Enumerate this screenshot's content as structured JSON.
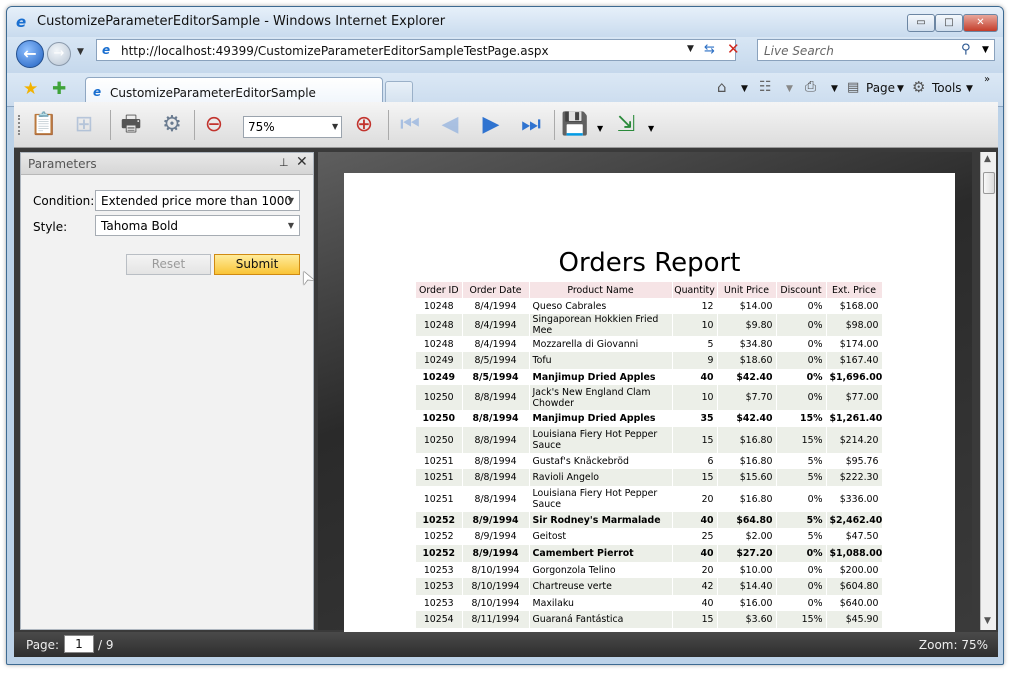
{
  "window": {
    "title": "CustomizeParameterEditorSample - Windows Internet Explorer",
    "minimize_glyph": "▭",
    "maximize_glyph": "□",
    "close_glyph": "✕"
  },
  "nav": {
    "back_glyph": "←",
    "forward_glyph": "→",
    "dropdown_glyph": "▼",
    "url": "http://localhost:49399/CustomizeParameterEditorSampleTestPage.aspx",
    "refresh_glyph": "⇆",
    "stop_glyph": "✕"
  },
  "search": {
    "placeholder": "Live Search",
    "icon_glyph": "⚲",
    "dropdown_glyph": "▼"
  },
  "tabs": [
    {
      "label": "CustomizeParameterEditorSample"
    }
  ],
  "favorites": {
    "star_glyph": "★",
    "add_glyph": "✚"
  },
  "commandbar": {
    "home_glyph": "⌂",
    "feeds_glyph": "☷",
    "print_glyph": "⎙",
    "page_glyph": "▤",
    "page_label": "Page",
    "tools_glyph": "⚙",
    "tools_label": "Tools",
    "dropdown_glyph": "▼",
    "more_glyph": "»"
  },
  "toolbar": {
    "parameters_glyph": "📋",
    "doc_map_glyph": "⊞",
    "print_glyph": "🖶",
    "print_setup_glyph": "⚙",
    "zoom_out_glyph": "⊖",
    "zoom_value": "75%",
    "zoom_dropdown_glyph": "▼",
    "zoom_in_glyph": "⊕",
    "first_glyph": "⏮",
    "prev_glyph": "◀",
    "next_glyph": "▶",
    "last_glyph": "⏭",
    "save_glyph": "💾",
    "export_glyph": "⇲",
    "dropdown_glyph": "▼"
  },
  "parameters": {
    "title": "Parameters",
    "pin_glyph": "⊥",
    "close_glyph": "✕",
    "condition_label": "Condition:",
    "condition_value": "Extended price more than 1000",
    "style_label": "Style:",
    "style_value": "Tahoma Bold",
    "dropdown_glyph": "▼",
    "reset_label": "Reset",
    "submit_label": "Submit",
    "cursor_glyph": "➤"
  },
  "report": {
    "title": "Orders Report",
    "columns": [
      "Order ID",
      "Order Date",
      "Product Name",
      "Quantity",
      "Unit Price",
      "Discount",
      "Ext. Price"
    ],
    "rows": [
      {
        "id": "10248",
        "date": "8/4/1994",
        "product": "Queso Cabrales",
        "qty": "12",
        "unit": "$14.00",
        "disc": "0%",
        "ext": "$168.00",
        "bold": false,
        "h": 16
      },
      {
        "id": "10248",
        "date": "8/4/1994",
        "product": "Singaporean Hokkien Fried Mee",
        "qty": "10",
        "unit": "$9.80",
        "disc": "0%",
        "ext": "$98.00",
        "bold": false,
        "h": 17
      },
      {
        "id": "10248",
        "date": "8/4/1994",
        "product": "Mozzarella di Giovanni",
        "qty": "5",
        "unit": "$34.80",
        "disc": "0%",
        "ext": "$174.00",
        "bold": false,
        "h": 16
      },
      {
        "id": "10249",
        "date": "8/5/1994",
        "product": "Tofu",
        "qty": "9",
        "unit": "$18.60",
        "disc": "0%",
        "ext": "$167.40",
        "bold": false,
        "h": 17
      },
      {
        "id": "10249",
        "date": "8/5/1994",
        "product": "Manjimup Dried Apples",
        "qty": "40",
        "unit": "$42.40",
        "disc": "0%",
        "ext": "$1,696.00",
        "bold": true,
        "h": 16
      },
      {
        "id": "10250",
        "date": "8/8/1994",
        "product": "Jack's New England Clam Chowder",
        "qty": "10",
        "unit": "$7.70",
        "disc": "0%",
        "ext": "$77.00",
        "bold": false,
        "h": 25
      },
      {
        "id": "10250",
        "date": "8/8/1994",
        "product": "Manjimup Dried Apples",
        "qty": "35",
        "unit": "$42.40",
        "disc": "15%",
        "ext": "$1,261.40",
        "bold": true,
        "h": 17
      },
      {
        "id": "10250",
        "date": "8/8/1994",
        "product": "Louisiana Fiery Hot Pepper Sauce",
        "qty": "15",
        "unit": "$16.80",
        "disc": "15%",
        "ext": "$214.20",
        "bold": false,
        "h": 26
      },
      {
        "id": "10251",
        "date": "8/8/1994",
        "product": "Gustaf's Knäckebröd",
        "qty": "6",
        "unit": "$16.80",
        "disc": "5%",
        "ext": "$95.76",
        "bold": false,
        "h": 16
      },
      {
        "id": "10251",
        "date": "8/8/1994",
        "product": "Ravioli Angelo",
        "qty": "15",
        "unit": "$15.60",
        "disc": "5%",
        "ext": "$222.30",
        "bold": false,
        "h": 17
      },
      {
        "id": "10251",
        "date": "8/8/1994",
        "product": "Louisiana Fiery Hot Pepper Sauce",
        "qty": "20",
        "unit": "$16.80",
        "disc": "0%",
        "ext": "$336.00",
        "bold": false,
        "h": 26
      },
      {
        "id": "10252",
        "date": "8/9/1994",
        "product": "Sir Rodney's Marmalade",
        "qty": "40",
        "unit": "$64.80",
        "disc": "5%",
        "ext": "$2,462.40",
        "bold": true,
        "h": 16
      },
      {
        "id": "10252",
        "date": "8/9/1994",
        "product": "Geitost",
        "qty": "25",
        "unit": "$2.00",
        "disc": "5%",
        "ext": "$47.50",
        "bold": false,
        "h": 17
      },
      {
        "id": "10252",
        "date": "8/9/1994",
        "product": "Camembert Pierrot",
        "qty": "40",
        "unit": "$27.20",
        "disc": "0%",
        "ext": "$1,088.00",
        "bold": true,
        "h": 17
      },
      {
        "id": "10253",
        "date": "8/10/1994",
        "product": "Gorgonzola Telino",
        "qty": "20",
        "unit": "$10.00",
        "disc": "0%",
        "ext": "$200.00",
        "bold": false,
        "h": 16
      },
      {
        "id": "10253",
        "date": "8/10/1994",
        "product": "Chartreuse verte",
        "qty": "42",
        "unit": "$14.40",
        "disc": "0%",
        "ext": "$604.80",
        "bold": false,
        "h": 17
      },
      {
        "id": "10253",
        "date": "8/10/1994",
        "product": "Maxilaku",
        "qty": "40",
        "unit": "$16.00",
        "disc": "0%",
        "ext": "$640.00",
        "bold": false,
        "h": 16
      },
      {
        "id": "10254",
        "date": "8/11/1994",
        "product": "Guaraná Fantástica",
        "qty": "15",
        "unit": "$3.60",
        "disc": "15%",
        "ext": "$45.90",
        "bold": false,
        "h": 17
      }
    ]
  },
  "scroll": {
    "up_glyph": "▲",
    "down_glyph": "▼"
  },
  "status": {
    "page_label": "Page:",
    "page_value": "1",
    "page_total": "/ 9",
    "zoom": "Zoom: 75%"
  }
}
